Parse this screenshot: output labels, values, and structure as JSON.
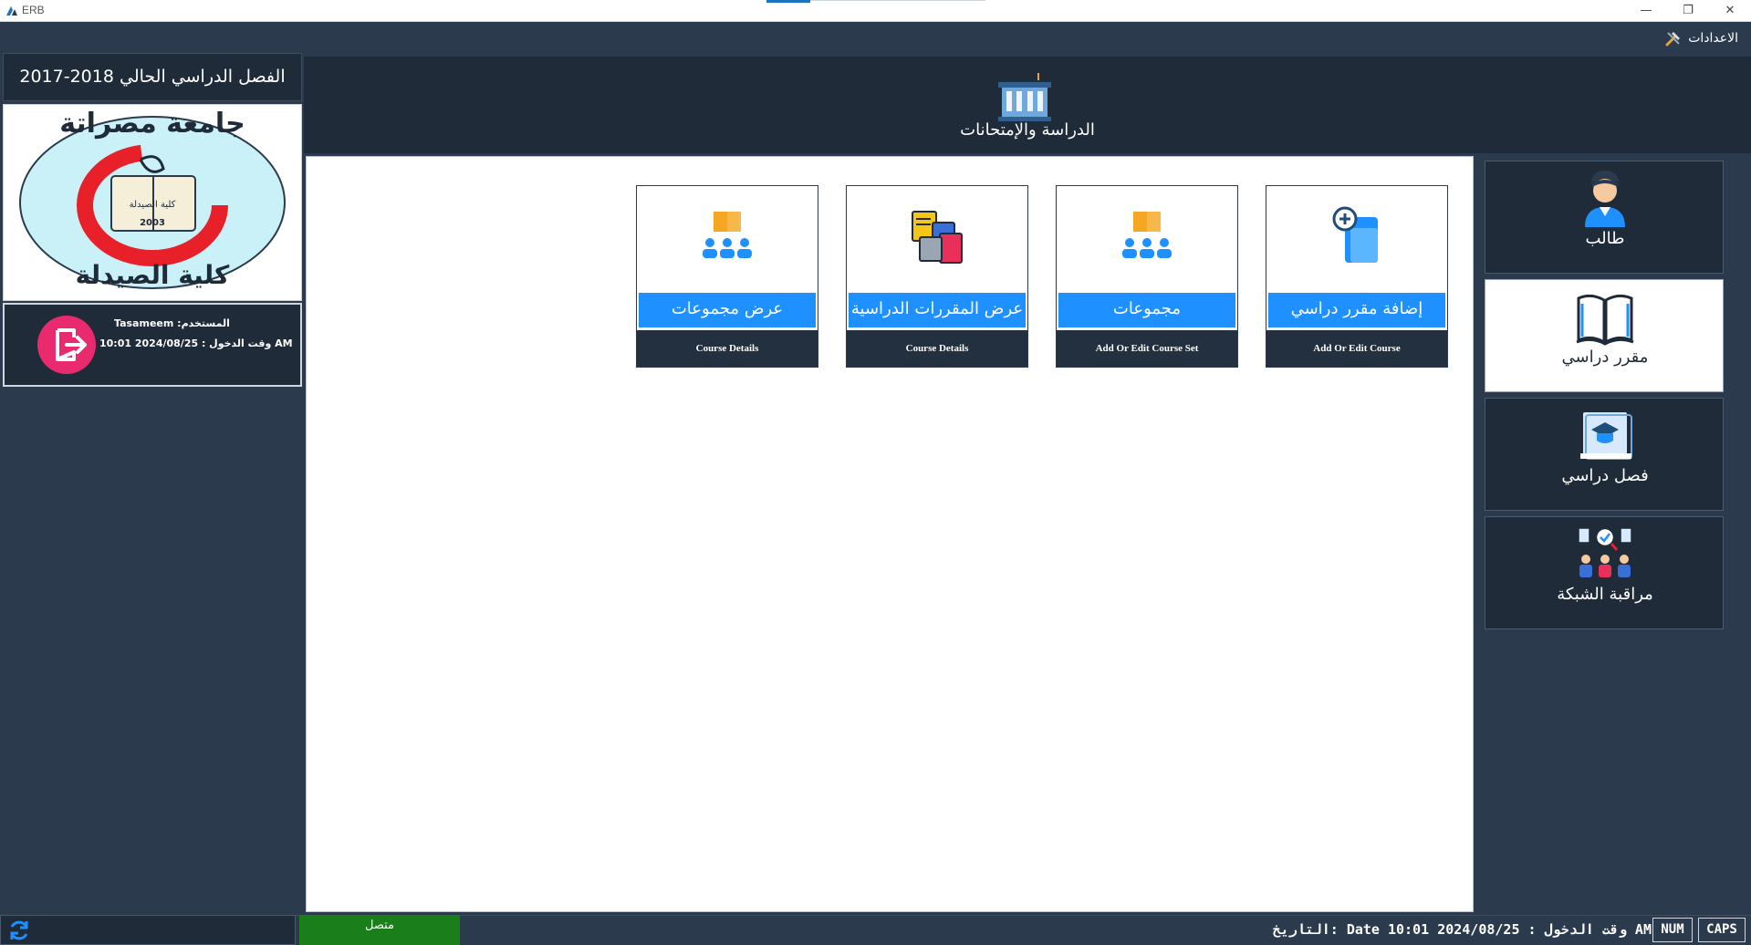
{
  "window": {
    "app_title": "ERB",
    "minimize_label": "—",
    "restore_label": "❐",
    "close_label": "✕"
  },
  "menu": {
    "settings_label": "الاعدادات",
    "settings_icon": "tools-icon"
  },
  "left_panel": {
    "semester": "الفصل الدراسي الحالي 2018-2017",
    "logo": {
      "top_text": "جامعة مصراتة",
      "bottom_text": "كلية الصيدلة",
      "book_text": "كلية الصيدلة",
      "year": "2003"
    },
    "user_label": "Tasameem :المستخدم",
    "login_time": "وقت الدخول : 2024/08/25 10:01 AM"
  },
  "header": {
    "title": "الدراسة والإمتحانات",
    "icon": "school-building-icon"
  },
  "cards": [
    {
      "title": "إضافة مقرر دراسي",
      "subtitle": "Add Or Edit Course",
      "icon": "add-document-icon"
    },
    {
      "title": "مجموعات",
      "subtitle": "Add Or Edit Course Set",
      "icon": "group-book-icon"
    },
    {
      "title": "عرض المقررات الدراسية",
      "subtitle": "Course Details",
      "icon": "books-stack-icon"
    },
    {
      "title": "عرض مجموعات",
      "subtitle": "Course Details",
      "icon": "group-book-icon"
    }
  ],
  "nav": [
    {
      "label": "طالب",
      "icon": "student-icon",
      "active": false
    },
    {
      "label": "مقرر دراسي",
      "icon": "open-book-icon",
      "active": true
    },
    {
      "label": "فصل دراسي",
      "icon": "graduation-calendar-icon",
      "active": false
    },
    {
      "label": "مراقبة الشبكة",
      "icon": "network-monitor-icon",
      "active": false
    }
  ],
  "statusbar": {
    "connection": "متصل",
    "datetime": "التاريخ: Date وقت الدخول : 2024/08/25 10:01 AM",
    "num": "NUM",
    "caps": "CAPS"
  },
  "colors": {
    "background": "#2b3a4c",
    "panel_dark": "#1f2b39",
    "accent_blue": "#1e90ff",
    "connected_green": "#1a7f1a",
    "logout_pink": "#ea2a6e"
  }
}
